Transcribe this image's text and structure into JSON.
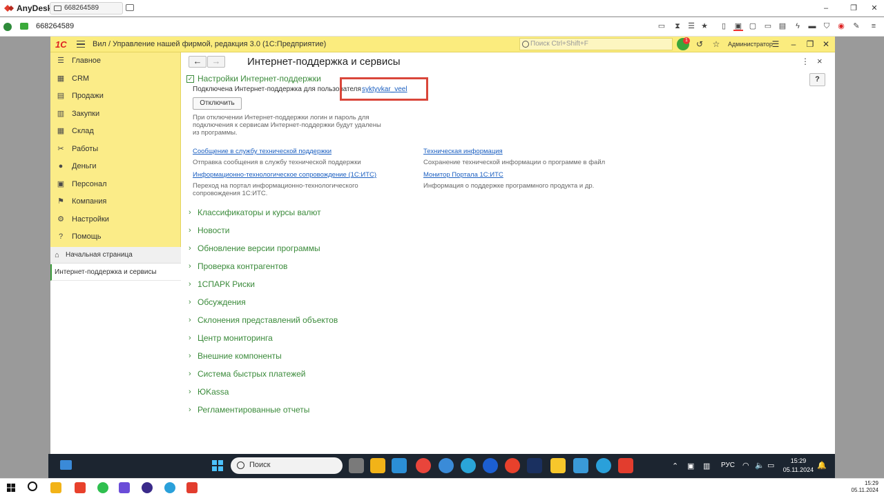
{
  "anydesk": {
    "app_name": "AnyDesk",
    "tab_label": "668264589",
    "address_id": "668264589"
  },
  "app": {
    "logo": "1С",
    "title": "Вил / Управление нашей фирмой, редакция 3.0  (1С:Предприятие)",
    "search_placeholder": "Поиск Ctrl+Shift+F",
    "notification_count": "1",
    "user": "Администратор"
  },
  "sidebar": {
    "items": [
      {
        "label": "Главное",
        "icon": "menu-icon"
      },
      {
        "label": "CRM",
        "icon": "crm-icon"
      },
      {
        "label": "Продажи",
        "icon": "cart-icon"
      },
      {
        "label": "Закупки",
        "icon": "purchase-icon"
      },
      {
        "label": "Склад",
        "icon": "warehouse-icon"
      },
      {
        "label": "Работы",
        "icon": "tools-icon"
      },
      {
        "label": "Деньги",
        "icon": "money-icon"
      },
      {
        "label": "Персонал",
        "icon": "staff-icon"
      },
      {
        "label": "Компания",
        "icon": "flag-icon"
      },
      {
        "label": "Настройки",
        "icon": "gear-icon"
      },
      {
        "label": "Помощь",
        "icon": "help-icon"
      }
    ],
    "home_label": "Начальная страница",
    "current_label": "Интернет-поддержка и сервисы"
  },
  "main": {
    "title": "Интернет-поддержка и сервисы",
    "help_label": "?",
    "section": {
      "title": "Настройки Интернет-поддержки",
      "connected_text": "Подключена Интернет-поддержка для пользователя",
      "user_link": "syktyvkar_veel",
      "disable_button": "Отключить",
      "disable_note": "При отключении Интернет-поддержки логин и пароль для подключения к сервисам Интернет-поддержки будут удалены из программы."
    },
    "links": [
      {
        "label": "Сообщение в службу технической поддержки",
        "desc": "Отправка сообщения в службу технической поддержки"
      },
      {
        "label": "Техническая информация",
        "desc": "Сохранение технической информации о программе в файл"
      },
      {
        "label": "Информационно-технологическое сопровождение (1С:ИТС)",
        "desc": "Переход на портал информационно-технологического сопровождения 1С:ИТС."
      },
      {
        "label": "Монитор Портала 1С:ИТС",
        "desc": "Информация о поддержке программного продукта и др."
      }
    ],
    "groups": [
      "Классификаторы и курсы валют",
      "Новости",
      "Обновление версии программы",
      "Проверка контрагентов",
      "1СПАРК Риски",
      "Обсуждения",
      "Склонения представлений объектов",
      "Центр мониторинга",
      "Внешние компоненты",
      "Система быстрых платежей",
      "ЮKassa",
      "Регламентированные отчеты"
    ]
  },
  "remote_taskbar": {
    "search_placeholder": "Поиск",
    "language": "РУС",
    "time": "15:29",
    "date": "05.11.2024"
  },
  "local_taskbar": {
    "time": "15:29",
    "date": "05.11.2024"
  },
  "colors": {
    "accent_green": "#3a8a3a",
    "sidebar_bg": "#fbec88",
    "link_blue": "#1b5fc1",
    "highlight_red": "#d9463a"
  }
}
